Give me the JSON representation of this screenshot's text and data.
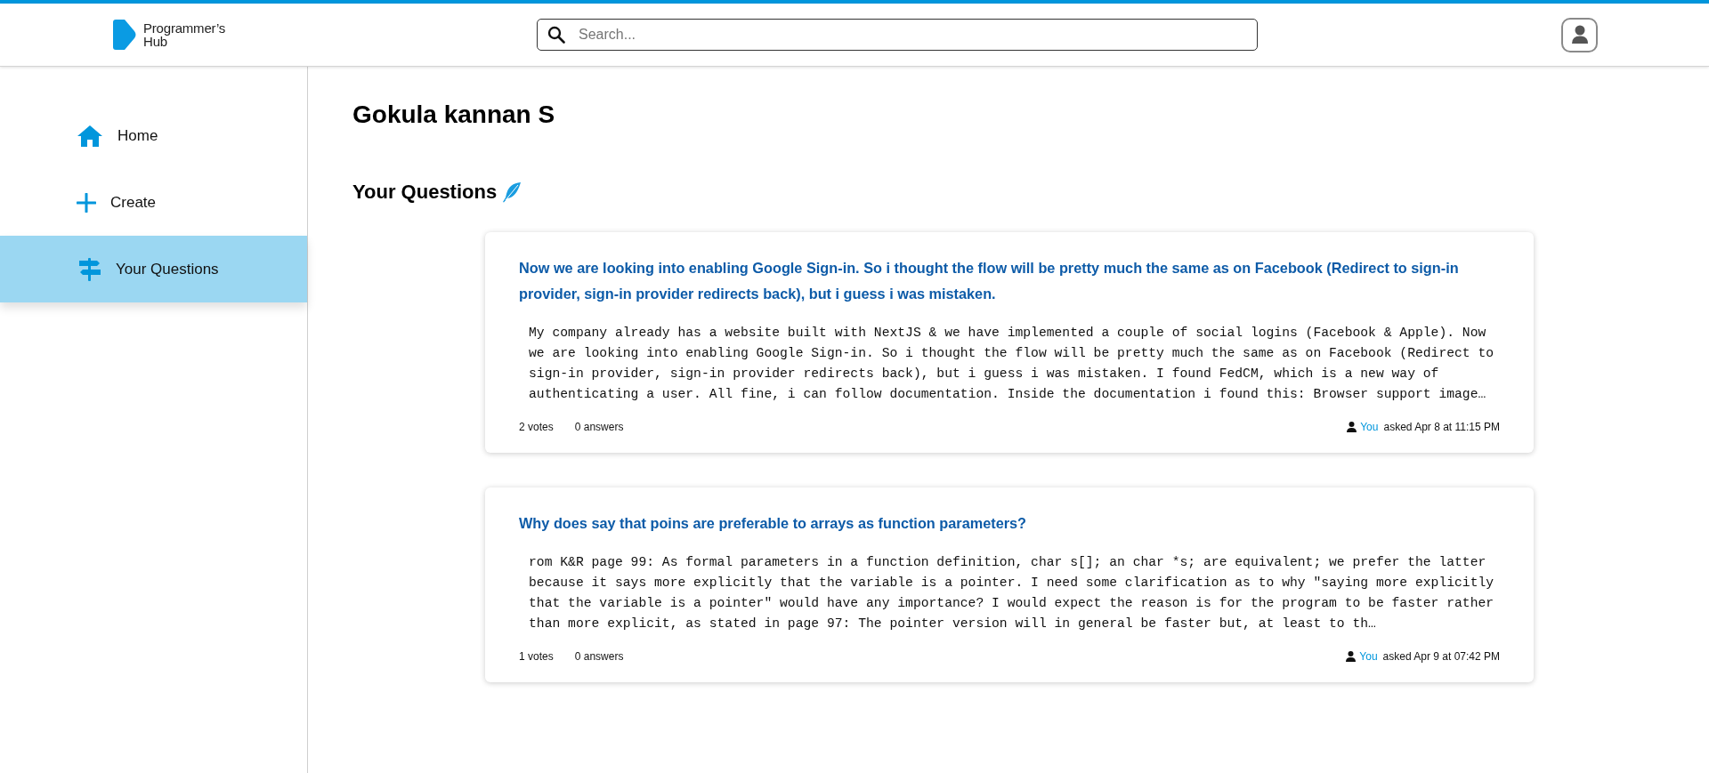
{
  "header": {
    "logo_text": [
      "Programmer’s",
      "Hub"
    ],
    "search": {
      "placeholder": "Search..."
    }
  },
  "sidebar": {
    "items": [
      {
        "kind": "home",
        "label": "Home",
        "selected": false
      },
      {
        "kind": "create",
        "label": "Create",
        "selected": false
      },
      {
        "kind": "questions",
        "label": "Your Questions",
        "selected": true
      }
    ]
  },
  "profile": {
    "name": "Gokula kannan S",
    "section_title": "Your Questions"
  },
  "questions": [
    {
      "title": "Now we are looking into enabling Google Sign-in. So i thought the flow will be pretty much the same as on Facebook (Redirect to sign-in provider, sign-in provider redirects back), but i guess i was mistaken.",
      "body": "My company already has a website built with NextJS & we have implemented a couple of social logins (Facebook & Apple). Now we are looking into enabling Google Sign-in. So i thought the flow will be pretty much the same as on Facebook (Redirect to sign-in provider, sign-in provider redirects back), but i guess i was mistaken. I found FedCM, which is a new way of authenticating a user. All fine, i can follow documentation. Inside the documentation i found this: Browser support image…",
      "votes": "2 votes",
      "answers": "0 answers",
      "author": "You",
      "asked": "asked Apr 8 at 11:15 PM"
    },
    {
      "title": "Why does say that poins are preferable to arrays as function parameters?",
      "body": "rom K&R page 99: As formal parameters in a function definition, char s[]; an char *s; are equivalent; we prefer the latter because it says more explicitly that the variable is a pointer. I need some clarification as to why \"saying more explicitly that the variable is a pointer\" would have any importance? I would expect the reason is for the program to be faster rather than more explicit, as stated in page 97: The pointer version will in general be faster but, at least to th…",
      "votes": "1 votes",
      "answers": "0 answers",
      "author": "You",
      "asked": "asked Apr 9 at 07:42 PM"
    }
  ]
}
